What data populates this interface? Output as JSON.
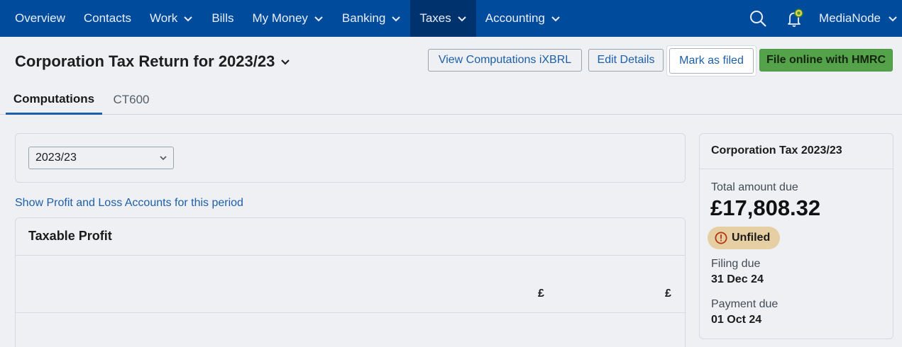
{
  "nav": {
    "items": [
      {
        "label": "Overview",
        "dropdown": false
      },
      {
        "label": "Contacts",
        "dropdown": false
      },
      {
        "label": "Work",
        "dropdown": true
      },
      {
        "label": "Bills",
        "dropdown": false
      },
      {
        "label": "My Money",
        "dropdown": true
      },
      {
        "label": "Banking",
        "dropdown": true
      },
      {
        "label": "Taxes",
        "dropdown": true
      },
      {
        "label": "Accounting",
        "dropdown": true
      }
    ],
    "active_item": "Taxes",
    "user": "MediaNode",
    "icons": [
      "search-icon",
      "notification-bell-icon"
    ],
    "colors": {
      "bar": "#004b9b",
      "active": "#00336d"
    }
  },
  "header": {
    "title": "Corporation Tax Return for 2023/23",
    "buttons": {
      "view_ixbrl": "View Computations iXBRL",
      "edit_details": "Edit Details",
      "mark_as_filed": "Mark as filed",
      "file_online": "File online with HMRC"
    }
  },
  "tabs": [
    {
      "label": "Computations",
      "active": true
    },
    {
      "label": "CT600",
      "active": false
    }
  ],
  "period_select": {
    "value": "2023/23"
  },
  "profit_loss_link": "Show Profit and Loss Accounts for this period",
  "taxable_profit": {
    "title": "Taxable Profit",
    "column_headers": [
      "£",
      "£"
    ]
  },
  "summary": {
    "title": "Corporation Tax 2023/23",
    "total_label": "Total amount due",
    "total_value": "£17,808.32",
    "status": "Unfiled",
    "status_color": "#e6cfa2",
    "filing_due_label": "Filing due",
    "filing_due_value": "31 Dec 24",
    "payment_due_label": "Payment due",
    "payment_due_value": "01 Oct 24"
  }
}
